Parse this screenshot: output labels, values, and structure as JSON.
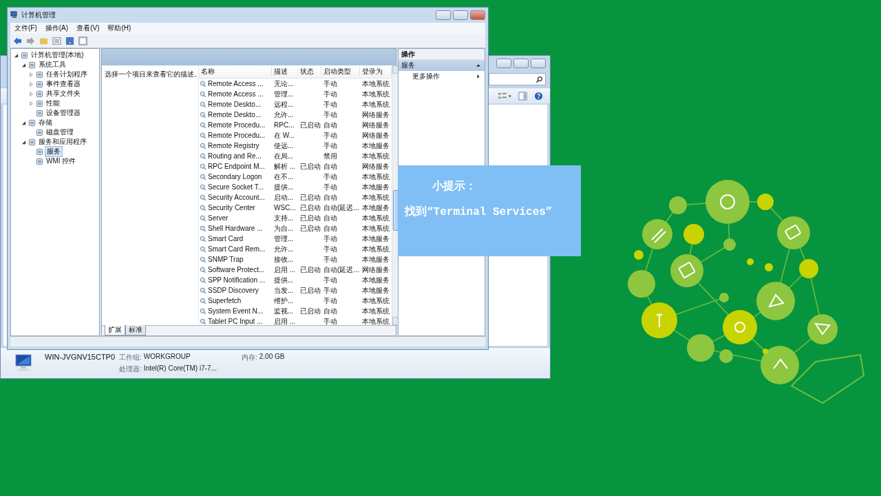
{
  "main_window": {
    "title": "计算机管理",
    "menu": [
      "文件(F)",
      "操作(A)",
      "查看(V)",
      "帮助(H)"
    ],
    "tree": [
      {
        "label": "计算机管理(本地)",
        "expanded": true,
        "selected": false,
        "children": [
          {
            "label": "系统工具",
            "expanded": true,
            "selected": false,
            "children": [
              {
                "label": "任务计划程序",
                "expanded": false,
                "selected": false
              },
              {
                "label": "事件查看器",
                "expanded": false,
                "selected": false
              },
              {
                "label": "共享文件夹",
                "expanded": false,
                "selected": false
              },
              {
                "label": "性能",
                "expanded": false,
                "selected": false
              },
              {
                "label": "设备管理器",
                "selected": false
              }
            ]
          },
          {
            "label": "存储",
            "expanded": true,
            "selected": false,
            "children": [
              {
                "label": "磁盘管理",
                "selected": false
              }
            ]
          },
          {
            "label": "服务和应用程序",
            "expanded": true,
            "selected": false,
            "children": [
              {
                "label": "服务",
                "selected": true
              },
              {
                "label": "WMI 控件",
                "selected": false
              }
            ]
          }
        ]
      }
    ],
    "description": "选择一个项目来查看它的描述。",
    "columns": [
      "名称",
      "描述",
      "状态",
      "启动类型",
      "登录为"
    ],
    "rows": [
      {
        "name": "Remote Access ...",
        "desc": "无论...",
        "type": "手动",
        "logon": "本地系统"
      },
      {
        "name": "Remote Access ...",
        "desc": "管理...",
        "type": "手动",
        "logon": "本地系统"
      },
      {
        "name": "Remote Deskto...",
        "desc": "远程...",
        "type": "手动",
        "logon": "本地系统"
      },
      {
        "name": "Remote Deskto...",
        "desc": "允许...",
        "type": "手动",
        "logon": "网络服务"
      },
      {
        "name": "Remote Procedu...",
        "desc": "RPC...",
        "status": "已启动",
        "type": "自动",
        "logon": "网络服务"
      },
      {
        "name": "Remote Procedu...",
        "desc": "在 W...",
        "type": "手动",
        "logon": "网络服务"
      },
      {
        "name": "Remote Registry",
        "desc": "使远...",
        "type": "手动",
        "logon": "本地服务"
      },
      {
        "name": "Routing and Re...",
        "desc": "在局...",
        "type": "禁用",
        "logon": "本地系统"
      },
      {
        "name": "RPC Endpoint M...",
        "desc": "解析 ...",
        "status": "已启动",
        "type": "自动",
        "logon": "网络服务"
      },
      {
        "name": "Secondary Logon",
        "desc": "在不...",
        "type": "手动",
        "logon": "本地系统"
      },
      {
        "name": "Secure Socket T...",
        "desc": "提供...",
        "type": "手动",
        "logon": "本地服务"
      },
      {
        "name": "Security Account...",
        "desc": "启动...",
        "status": "已启动",
        "type": "自动",
        "logon": "本地系统"
      },
      {
        "name": "Security Center",
        "desc": "WSC...",
        "status": "已启动",
        "type": "自动(延迟...",
        "logon": "本地服务"
      },
      {
        "name": "Server",
        "desc": "支持...",
        "status": "已启动",
        "type": "自动",
        "logon": "本地系统"
      },
      {
        "name": "Shell Hardware ...",
        "desc": "为自...",
        "status": "已启动",
        "type": "自动",
        "logon": "本地系统"
      },
      {
        "name": "Smart Card",
        "desc": "管理...",
        "type": "手动",
        "logon": "本地服务"
      },
      {
        "name": "Smart Card Rem...",
        "desc": "允许...",
        "type": "手动",
        "logon": "本地系统"
      },
      {
        "name": "SNMP Trap",
        "desc": "接收...",
        "type": "手动",
        "logon": "本地服务"
      },
      {
        "name": "Software Protect...",
        "desc": "启用 ...",
        "status": "已启动",
        "type": "自动(延迟...",
        "logon": "网络服务"
      },
      {
        "name": "SPP Notification ...",
        "desc": "提供...",
        "type": "手动",
        "logon": "本地服务"
      },
      {
        "name": "SSDP Discovery",
        "desc": "当发...",
        "status": "已启动",
        "type": "手动",
        "logon": "本地服务"
      },
      {
        "name": "Superfetch",
        "desc": "维护...",
        "type": "手动",
        "logon": "本地系统"
      },
      {
        "name": "System Event N...",
        "desc": "监视...",
        "status": "已启动",
        "type": "自动",
        "logon": "本地系统"
      },
      {
        "name": "Tablet PC Input ...",
        "desc": "启用 ...",
        "type": "手动",
        "logon": "本地系统"
      }
    ],
    "tabs": [
      {
        "label": "扩展",
        "selected": true
      },
      {
        "label": "标准",
        "selected": false
      }
    ],
    "actions": {
      "header": "操作",
      "section": {
        "label": "服务",
        "expanded": true
      },
      "items": [
        "更多操作"
      ]
    }
  },
  "back_window": {
    "details": {
      "computer": "WIN-JVGNV15CTP0",
      "fields": [
        {
          "label": "工作组:",
          "value": "WORKGROUP"
        },
        {
          "label": "内存:",
          "value": "2.00 GB"
        },
        {
          "label": "处理器:",
          "value": "Intel(R) Core(TM) i7-7..."
        }
      ]
    }
  },
  "tip": {
    "title": "小提示：",
    "text": "找到“Terminal Services”"
  }
}
